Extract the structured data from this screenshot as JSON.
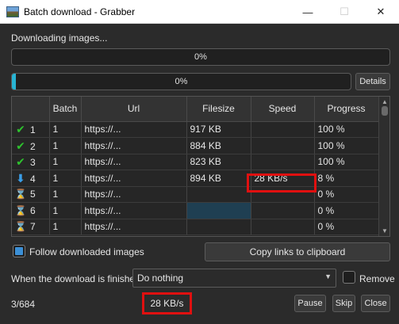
{
  "window": {
    "title": "Batch download - Grabber",
    "minimize_glyph": "—",
    "maximize_glyph": "☐",
    "close_glyph": "✕"
  },
  "status": {
    "downloading_label": "Downloading images..."
  },
  "progress": {
    "overall_text": "0%",
    "overall_value": 0.0,
    "current_text": "0%",
    "current_value": 0.0,
    "details_label": "Details"
  },
  "table": {
    "columns": [
      "",
      "Batch",
      "Url",
      "Filesize",
      "Speed",
      "Progress"
    ],
    "rows": [
      {
        "icon": "check-icon",
        "glyph": "✔",
        "id": "1",
        "batch": "1",
        "url": "https://...",
        "filesize": "917 KB",
        "speed": "",
        "progress": "100 %"
      },
      {
        "icon": "check-icon",
        "glyph": "✔",
        "id": "2",
        "batch": "1",
        "url": "https://...",
        "filesize": "884 KB",
        "speed": "",
        "progress": "100 %"
      },
      {
        "icon": "check-icon",
        "glyph": "✔",
        "id": "3",
        "batch": "1",
        "url": "https://...",
        "filesize": "823 KB",
        "speed": "",
        "progress": "100 %"
      },
      {
        "icon": "download-arrow-icon",
        "glyph": "⬇",
        "id": "4",
        "batch": "1",
        "url": "https://...",
        "filesize": "894 KB",
        "speed": "28 KB/s",
        "progress": "8 %"
      },
      {
        "icon": "hourglass-icon",
        "glyph": "⌛",
        "id": "5",
        "batch": "1",
        "url": "https://...",
        "filesize": "",
        "speed": "",
        "progress": "0 %"
      },
      {
        "icon": "hourglass-icon",
        "glyph": "⌛",
        "id": "6",
        "batch": "1",
        "url": "https://...",
        "filesize": "",
        "speed": "",
        "progress": "0 %"
      },
      {
        "icon": "hourglass-icon",
        "glyph": "⌛",
        "id": "7",
        "batch": "1",
        "url": "https://...",
        "filesize": "",
        "speed": "",
        "progress": "0 %"
      }
    ]
  },
  "options": {
    "follow_label": "Follow downloaded images",
    "follow_checked": true,
    "copy_links_label": "Copy links to clipboard",
    "when_finished_label": "When the download is finished",
    "when_finished_value": "Do nothing",
    "remove_label": "Remove",
    "remove_checked": false
  },
  "footer": {
    "count": "3/684",
    "speed": "28 KB/s",
    "pause_label": "Pause",
    "skip_label": "Skip",
    "close_label": "Close"
  },
  "colors": {
    "accent": "#28b4d4",
    "highlight_box": "#e01010",
    "done_icon": "#2ec22e",
    "download_icon": "#3a9ee8"
  }
}
